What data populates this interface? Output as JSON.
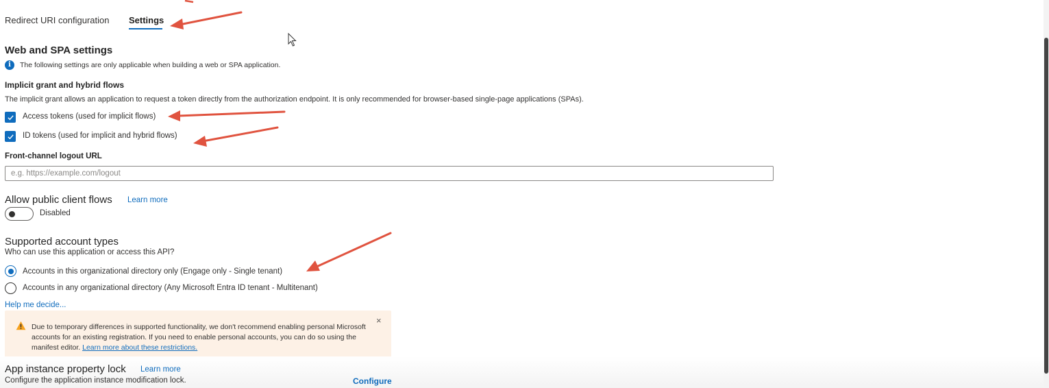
{
  "tabs": [
    {
      "label": "Redirect URI configuration",
      "active": false
    },
    {
      "label": "Settings",
      "active": true
    }
  ],
  "web_spa": {
    "title": "Web and SPA settings",
    "info": "The following settings are only applicable when building a web or SPA application."
  },
  "implicit": {
    "title": "Implicit grant and hybrid flows",
    "description": "The implicit grant allows an application to request a token directly from the authorization endpoint.  It is only recommended for browser-based single-page applications (SPAs).",
    "access_tokens": {
      "label": "Access tokens (used for implicit flows)",
      "checked": true
    },
    "id_tokens": {
      "label": "ID tokens (used for implicit and hybrid flows)",
      "checked": true
    }
  },
  "logout": {
    "label": "Front-channel logout URL",
    "placeholder": "e.g. https://example.com/logout",
    "value": ""
  },
  "public_client": {
    "title": "Allow public client flows",
    "learn_more": "Learn more",
    "state": "Disabled",
    "enabled": false
  },
  "account_types": {
    "title": "Supported account types",
    "question": "Who can use this application or access this API?",
    "options": [
      {
        "label": "Accounts in this organizational directory only (Engage only - Single tenant)",
        "selected": true
      },
      {
        "label": "Accounts in any organizational directory (Any Microsoft Entra ID tenant - Multitenant)",
        "selected": false
      }
    ],
    "help": "Help me decide..."
  },
  "warning": {
    "text": "Due to temporary differences in supported functionality, we don't recommend enabling personal Microsoft accounts for an existing registration. If you need to enable personal accounts, you can do so using the manifest editor.",
    "link": "Learn more about these restrictions.",
    "close": "×"
  },
  "app_lock": {
    "title": "App instance property lock",
    "learn_more": "Learn more",
    "description": "Configure the application instance modification lock.",
    "configure": "Configure"
  },
  "colors": {
    "accent": "#0f6cbd",
    "warning_bg": "#fdf1e6",
    "warning_icon": "#f7a21e",
    "annotation_arrow": "#e0533f"
  }
}
